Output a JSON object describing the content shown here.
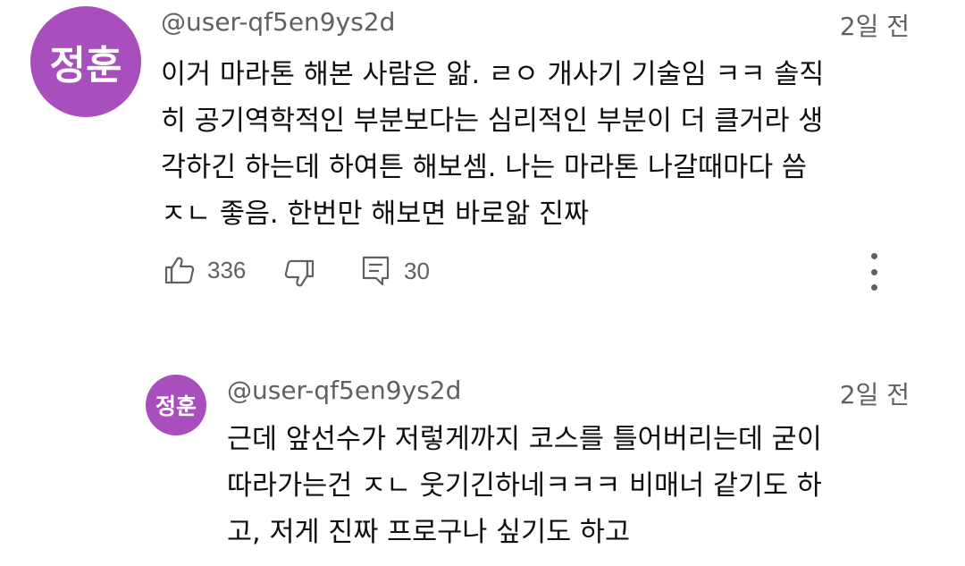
{
  "comment": {
    "avatar_text": "정훈",
    "avatar_color": "#a84fbd",
    "username": "@user-qf5en9ys2d",
    "timestamp": "2일 전",
    "lines": [
      "이거 마라톤 해본 사람은 앎. ㄹㅇ 개사기 기술임 ㅋㅋ 솔직",
      "히 공기역학적인 부분보다는 심리적인 부분이 더 클거라 생",
      "각하긴 하는데 하여튼 해보셈. 나는 마라톤 나갈때마다 씀",
      "ㅈㄴ 좋음. 한번만 해보면 바로앎 진짜"
    ],
    "like_count": "336",
    "reply_count": "30",
    "icons": {
      "like": "thumbs-up-icon",
      "dislike": "thumbs-down-icon",
      "reply": "comment-icon",
      "more": "more-vertical-icon"
    }
  },
  "reply": {
    "avatar_text": "정훈",
    "avatar_color": "#a84fbd",
    "username": "@user-qf5en9ys2d",
    "timestamp": "2일 전",
    "lines": [
      "근데 앞선수가 저렇게까지 코스를 틀어버리는데 굳이",
      "따라가는건 ㅈㄴ 웃기긴하네ㅋㅋㅋ 비매너 같기도 하",
      "고, 저게 진짜 프로구나 싶기도 하고"
    ]
  }
}
